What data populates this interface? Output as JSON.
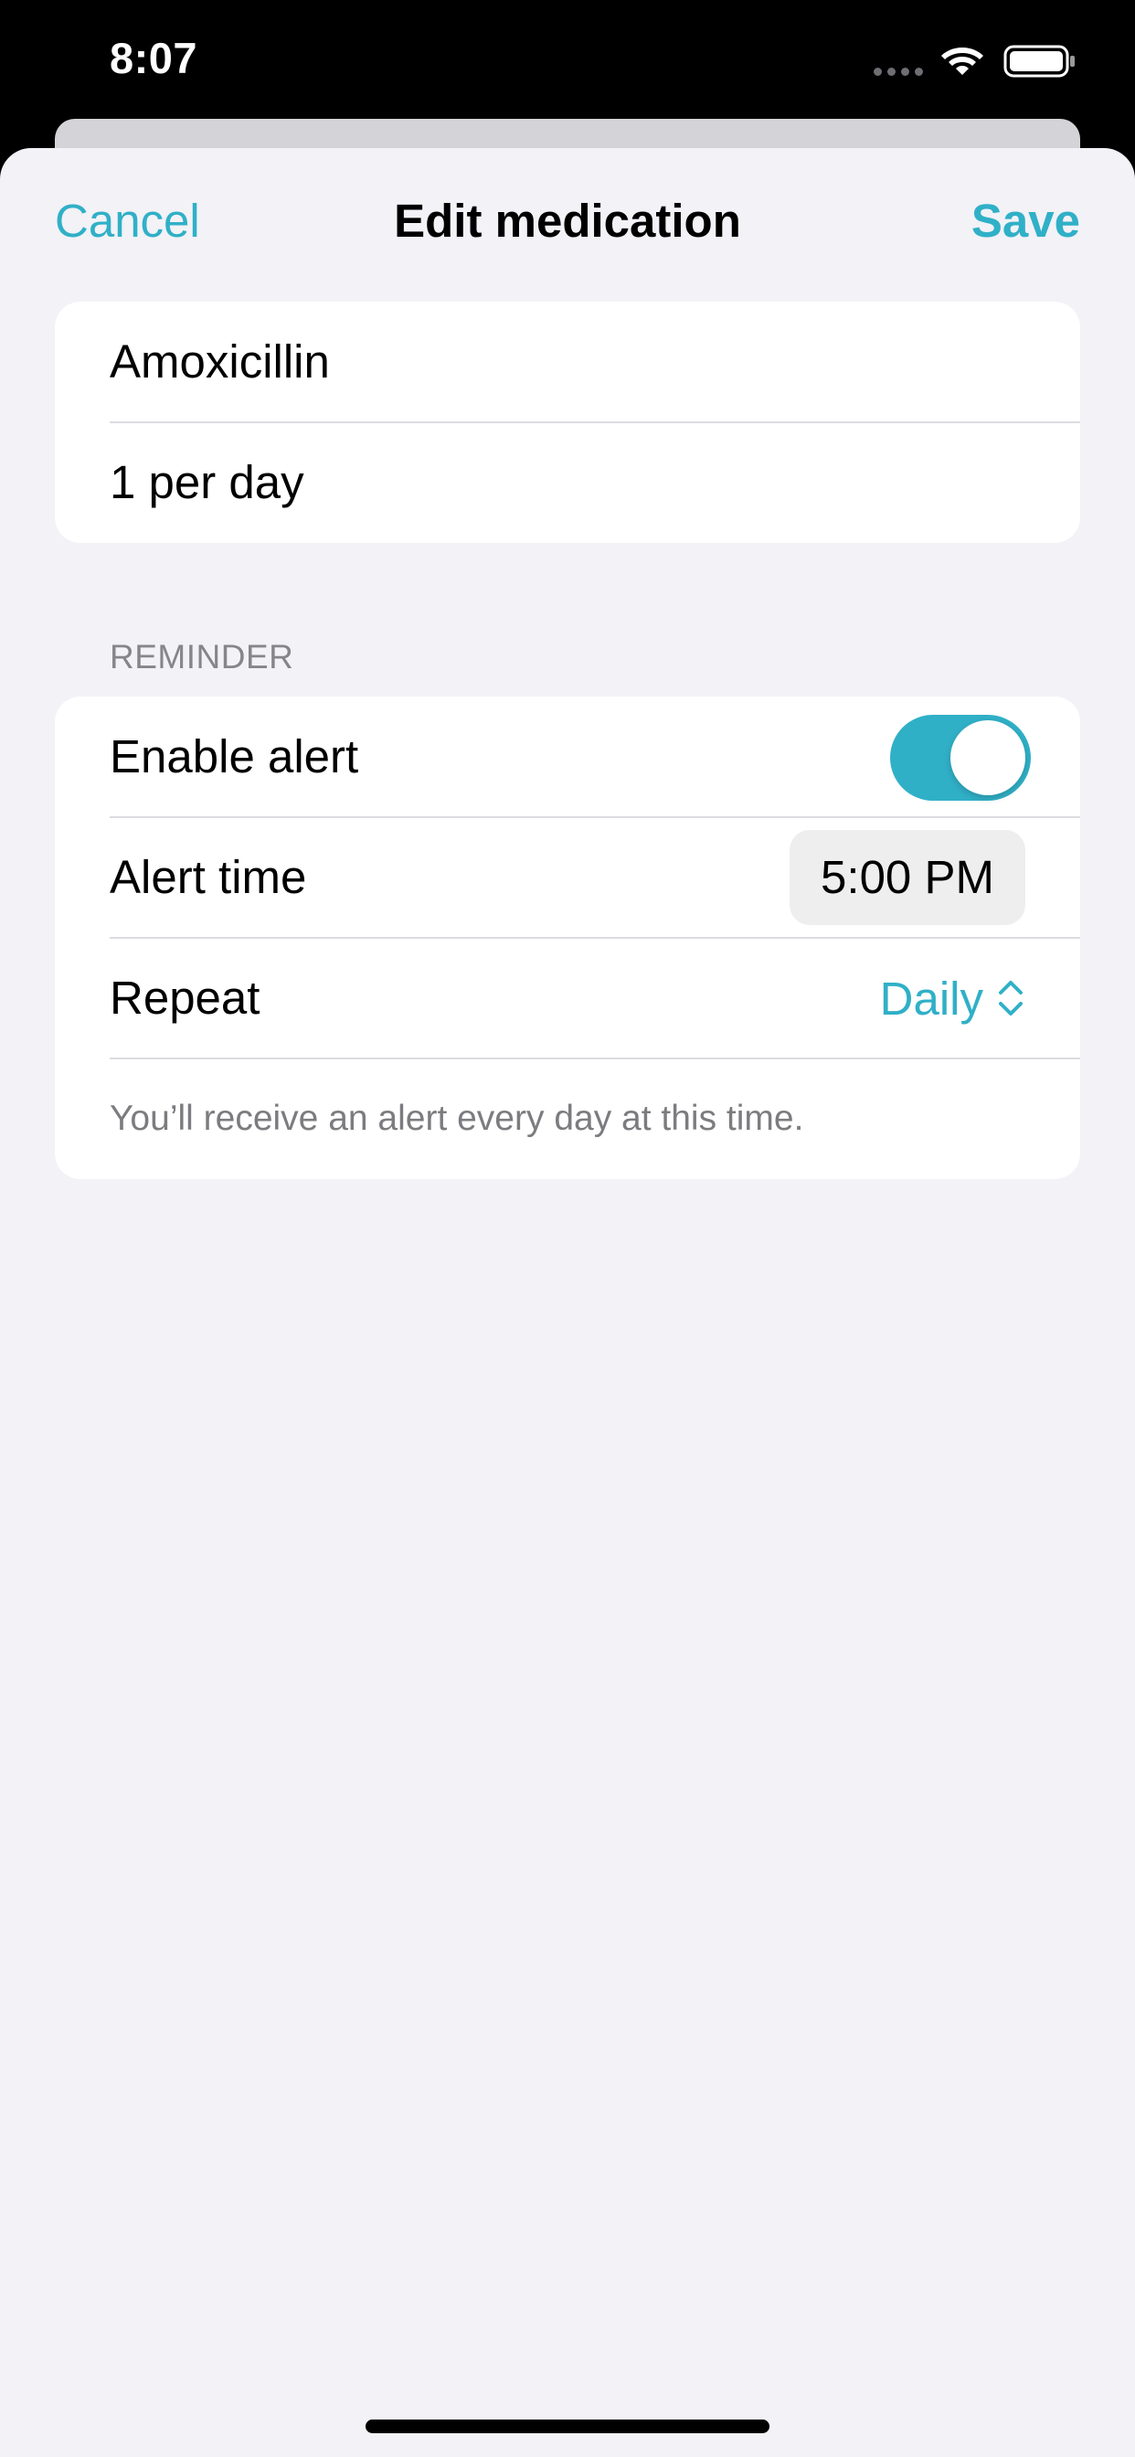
{
  "status_bar": {
    "time": "8:07"
  },
  "nav": {
    "cancel_label": "Cancel",
    "title": "Edit medication",
    "save_label": "Save"
  },
  "medication": {
    "name": "Amoxicillin",
    "dosage": "1 per day"
  },
  "reminder": {
    "section_header": "REMINDER",
    "enable_alert_label": "Enable alert",
    "enable_alert_on": true,
    "alert_time_label": "Alert time",
    "alert_time_value": "5:00 PM",
    "repeat_label": "Repeat",
    "repeat_value": "Daily",
    "note": "You’ll receive an alert every day at this time."
  },
  "colors": {
    "accent": "#30b0c7",
    "background": "#f2f2f7",
    "card": "#ffffff",
    "secondary_text": "#85858a"
  },
  "icons": {
    "wifi": "wifi-icon",
    "battery": "battery-icon",
    "repeat_chevron": "chevron-updown-icon"
  }
}
